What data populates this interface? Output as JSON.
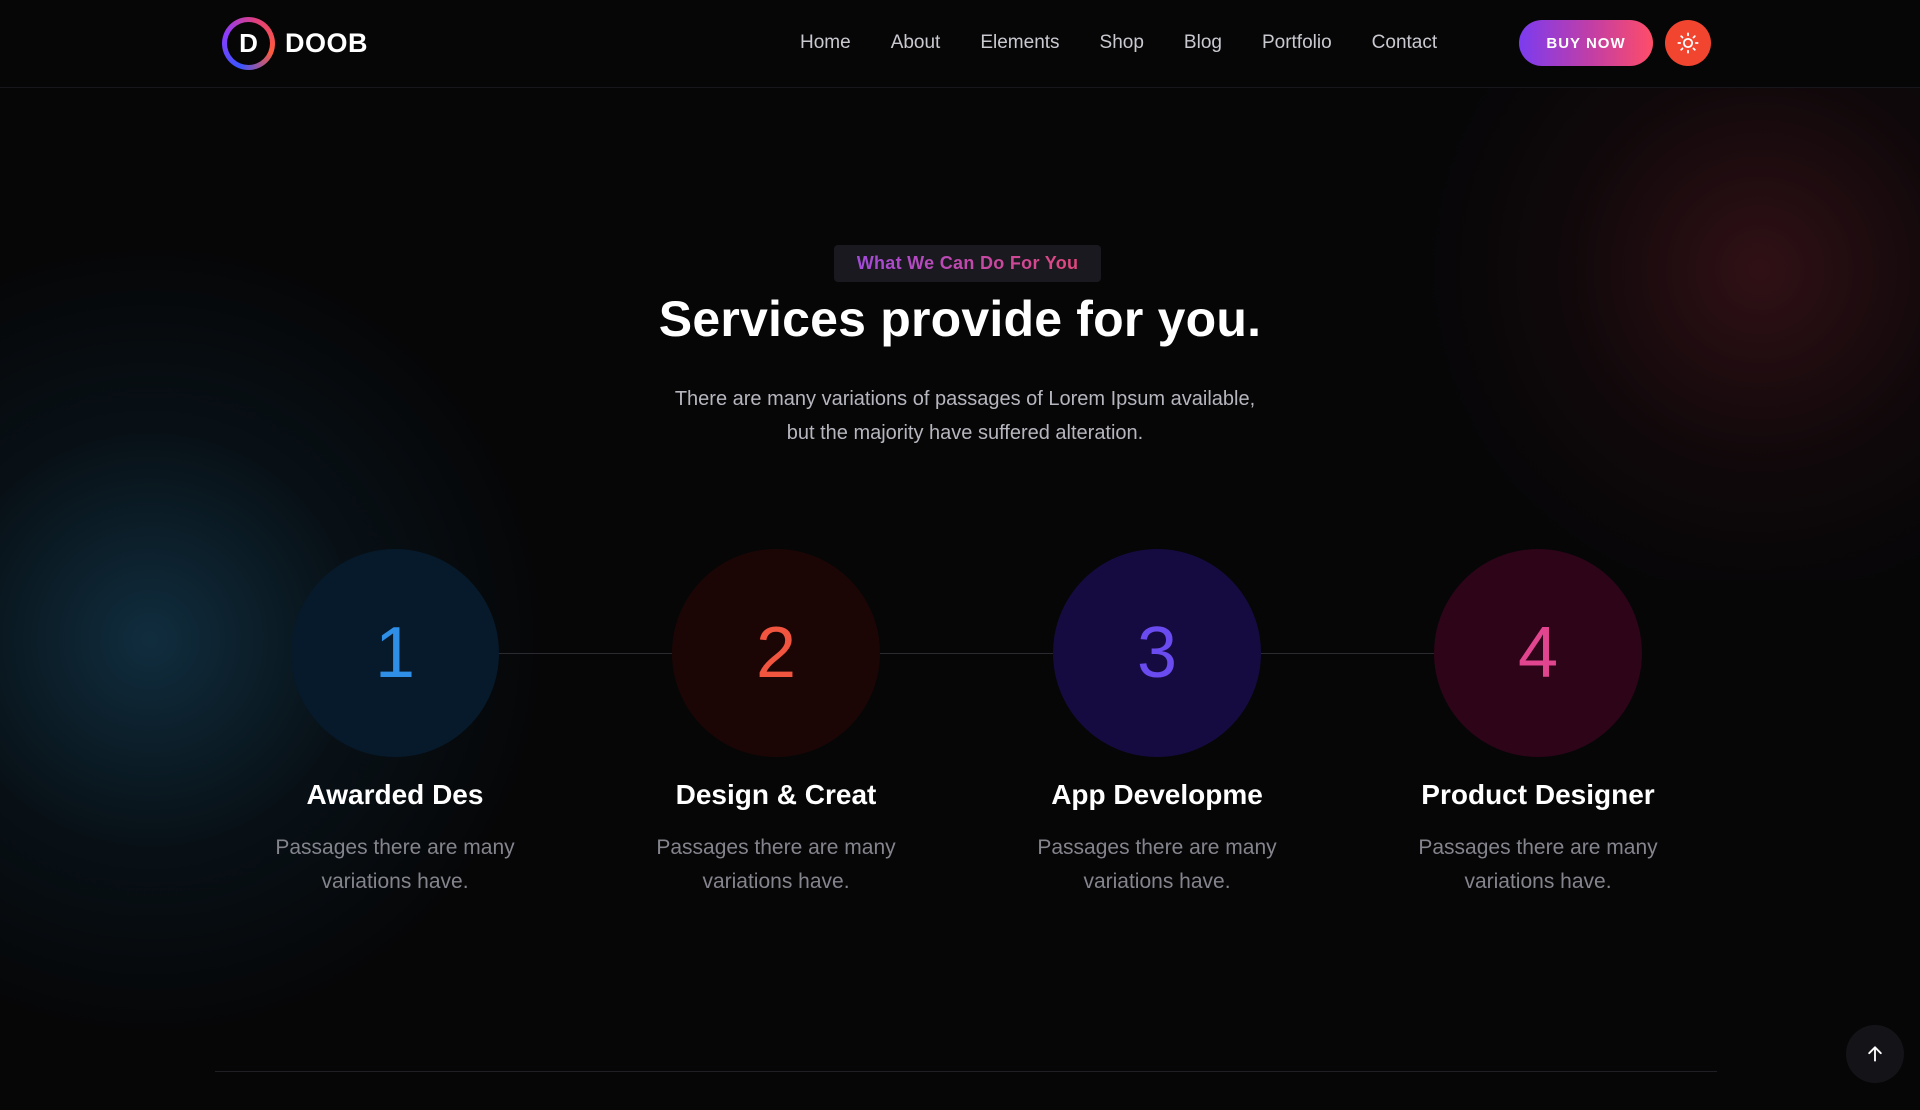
{
  "header": {
    "logo_letter": "D",
    "logo_text": "DOOB",
    "nav": [
      "Home",
      "About",
      "Elements",
      "Shop",
      "Blog",
      "Portfolio",
      "Contact"
    ],
    "buy_label": "BUY NOW",
    "theme_icon": "sun-icon"
  },
  "intro": {
    "tagline": "What We Can Do For You",
    "title": "Services provide for you.",
    "description_line1": "There are many variations of passages of Lorem Ipsum available,",
    "description_line2": "but the majority have suffered alteration."
  },
  "steps": [
    {
      "number": "1",
      "title": "Awarded Des",
      "desc": "Passages there are many variations have.",
      "number_color": "#2f8fe6",
      "circle_color": "#061a2b"
    },
    {
      "number": "2",
      "title": "Design & Creat",
      "desc": "Passages there are many variations have.",
      "number_color": "#f2553f",
      "circle_color": "#1c0605"
    },
    {
      "number": "3",
      "title": "App Developme",
      "desc": "Passages there are many variations have.",
      "number_color": "#6a4bf0",
      "circle_color": "#160b40"
    },
    {
      "number": "4",
      "title": "Product Designer",
      "desc": "Passages there are many variations have.",
      "number_color": "#e2458f",
      "circle_color": "#2d0418"
    }
  ],
  "scroll_top_icon": "arrow-up-icon"
}
